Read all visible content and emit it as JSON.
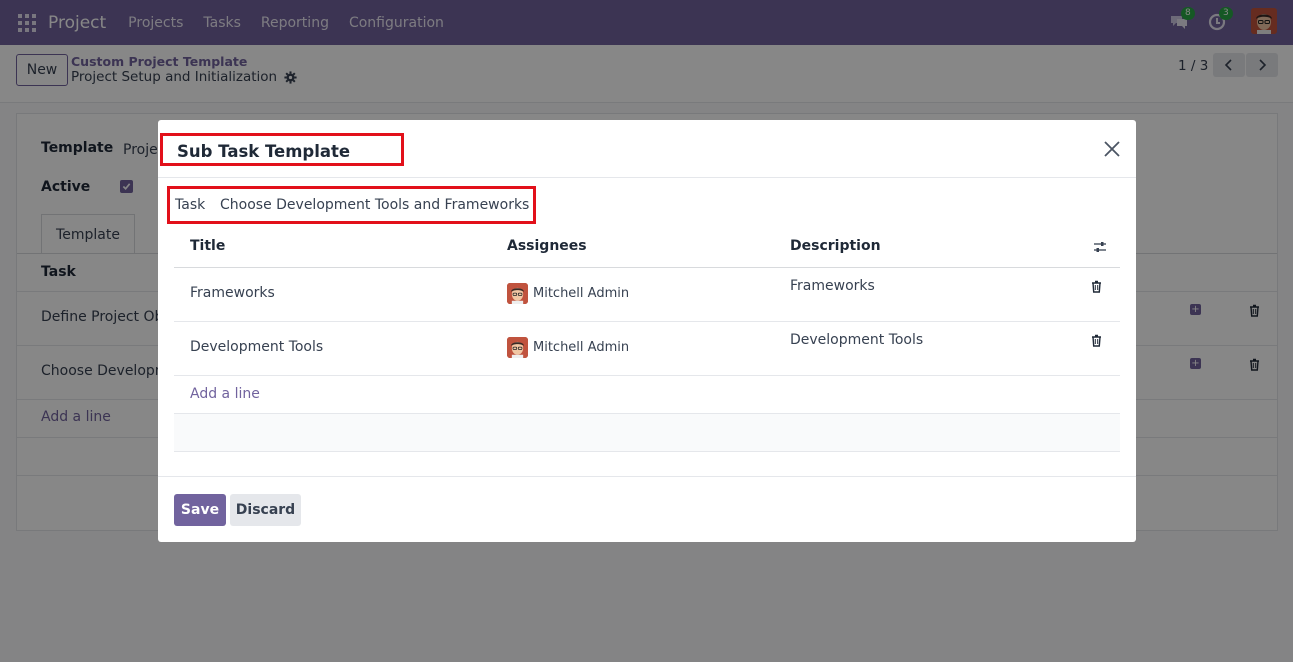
{
  "navbar": {
    "app_name": "Project",
    "menu": [
      "Projects",
      "Tasks",
      "Reporting",
      "Configuration"
    ],
    "messages_count": "8",
    "activities_count": "3"
  },
  "control_panel": {
    "new_label": "New",
    "breadcrumb_parent": "Custom Project Template",
    "breadcrumb_current": "Project Setup and Initialization",
    "pager": "1 / 3"
  },
  "form": {
    "template_label": "Template",
    "template_value": "Projec",
    "active_label": "Active",
    "active_checked": true,
    "tab_label": "Template",
    "task_column": "Task",
    "rows": [
      "Define Project Obj",
      "Choose Developme"
    ],
    "add_line": "Add a line"
  },
  "modal": {
    "title": "Sub Task Template",
    "task_label": "Task",
    "task_value": "Choose Development Tools and Frameworks",
    "columns": {
      "title": "Title",
      "assignees": "Assignees",
      "description": "Description"
    },
    "rows": [
      {
        "title": "Frameworks",
        "assignee": "Mitchell Admin",
        "description": "Frameworks"
      },
      {
        "title": "Development Tools",
        "assignee": "Mitchell Admin",
        "description": "Development Tools"
      }
    ],
    "add_line": "Add a line",
    "save_label": "Save",
    "discard_label": "Discard"
  },
  "colors": {
    "brand": "#71639e",
    "highlight": "#e2101a"
  }
}
